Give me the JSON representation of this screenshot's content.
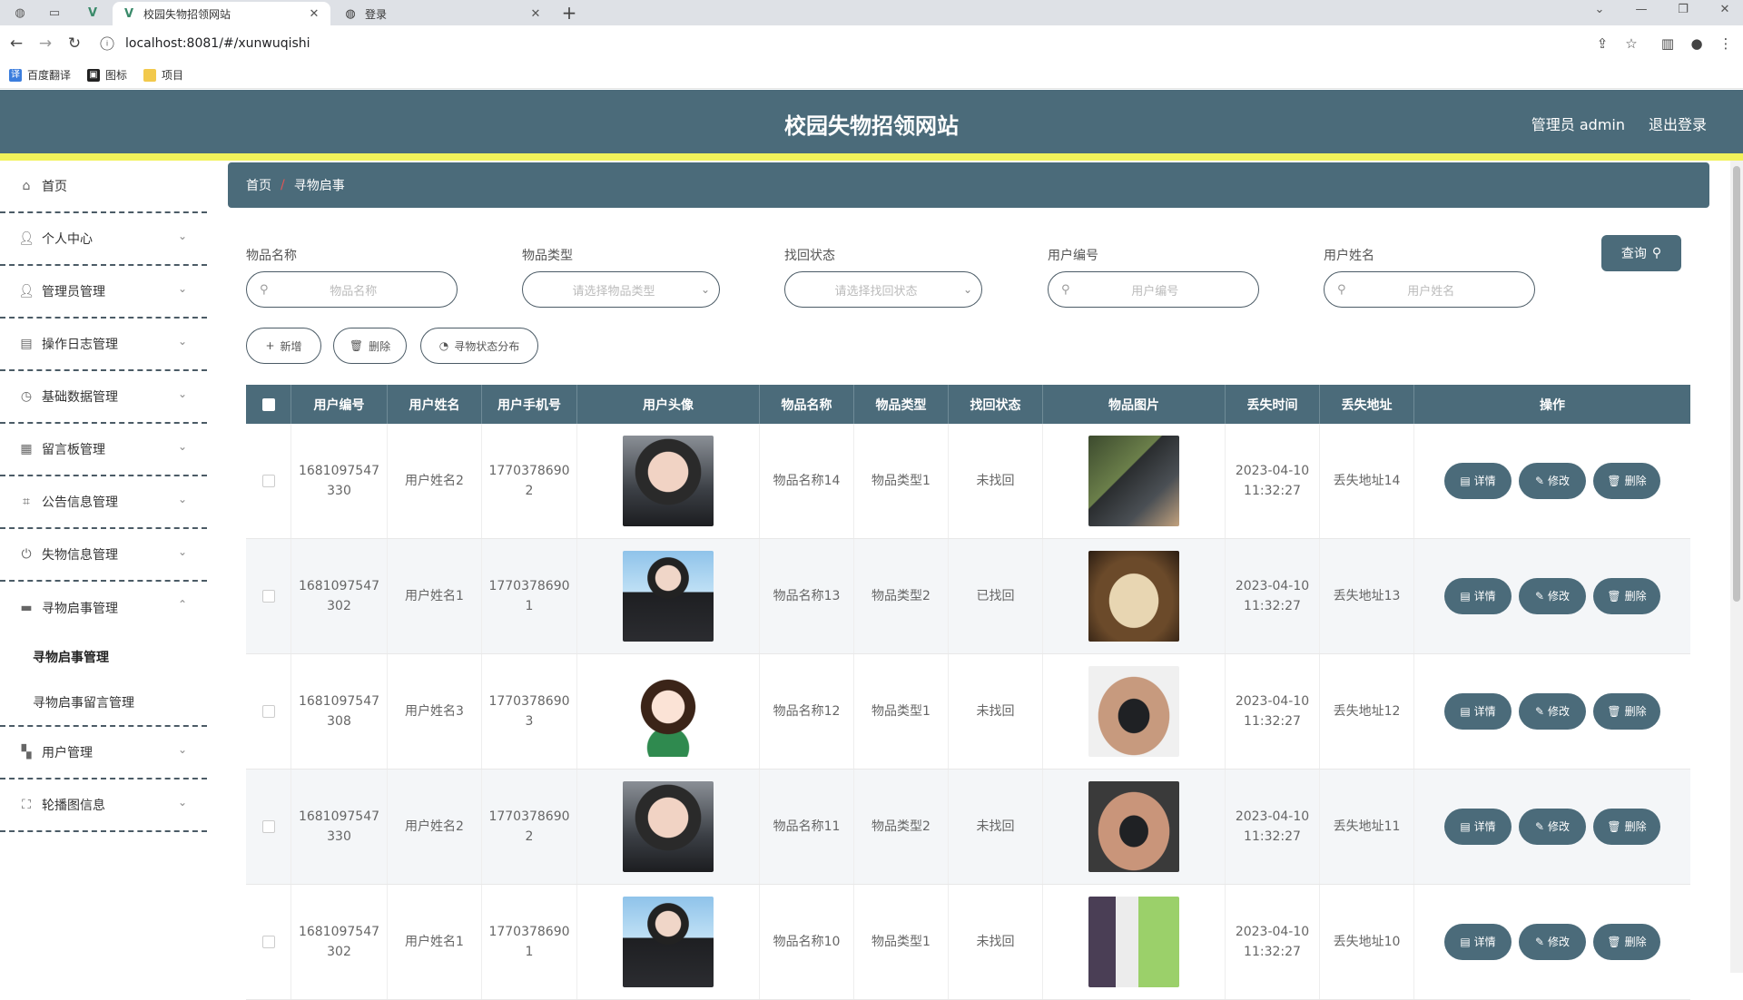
{
  "browser": {
    "tabs": [
      {
        "title": "校园失物招领网站",
        "active": true
      },
      {
        "title": "登录",
        "active": false
      }
    ],
    "url": "localhost:8081/#/xunwuqishi",
    "bookmarks": [
      "百度翻译",
      "图标",
      "项目"
    ]
  },
  "header": {
    "title": "校园失物招领网站",
    "user": "管理员 admin",
    "logout": "退出登录"
  },
  "sidebar": {
    "items": [
      {
        "label": "首页",
        "icon": "home-icon"
      },
      {
        "label": "个人中心",
        "icon": "user-icon"
      },
      {
        "label": "管理员管理",
        "icon": "user-icon"
      },
      {
        "label": "操作日志管理",
        "icon": "briefcase-icon"
      },
      {
        "label": "基础数据管理",
        "icon": "gauge-icon"
      },
      {
        "label": "留言板管理",
        "icon": "clipboard-icon"
      },
      {
        "label": "公告信息管理",
        "icon": "crop-icon"
      },
      {
        "label": "失物信息管理",
        "icon": "power-icon"
      },
      {
        "label": "寻物启事管理",
        "icon": "monitor-icon"
      },
      {
        "label": "用户管理",
        "icon": "grid-icon"
      },
      {
        "label": "轮播图信息",
        "icon": "fullscreen-icon"
      }
    ],
    "submenu": [
      "寻物启事管理",
      "寻物启事留言管理"
    ]
  },
  "breadcrumb": {
    "home": "首页",
    "sep": "/",
    "current": "寻物启事"
  },
  "filters": [
    {
      "label": "物品名称",
      "placeholder": "物品名称",
      "type": "input"
    },
    {
      "label": "物品类型",
      "placeholder": "请选择物品类型",
      "type": "select"
    },
    {
      "label": "找回状态",
      "placeholder": "请选择找回状态",
      "type": "select"
    },
    {
      "label": "用户编号",
      "placeholder": "用户编号",
      "type": "input"
    },
    {
      "label": "用户姓名",
      "placeholder": "用户姓名",
      "type": "input"
    }
  ],
  "search_label": "查询",
  "actions": {
    "add": "新增",
    "delete": "删除",
    "stats": "寻物状态分布"
  },
  "table": {
    "columns": [
      "用户编号",
      "用户姓名",
      "用户手机号",
      "用户头像",
      "物品名称",
      "物品类型",
      "找回状态",
      "物品图片",
      "丢失时间",
      "丢失地址",
      "操作"
    ],
    "ops": {
      "detail": "详情",
      "edit": "修改",
      "delete": "删除"
    },
    "rows": [
      {
        "id": "1681097547330",
        "name": "用户姓名2",
        "phone": "17703786902",
        "item": "物品名称14",
        "type": "物品类型1",
        "status": "未找回",
        "time": "2023-04-10 11:32:27",
        "addr": "丢失地址14"
      },
      {
        "id": "1681097547302",
        "name": "用户姓名1",
        "phone": "17703786901",
        "item": "物品名称13",
        "type": "物品类型2",
        "status": "已找回",
        "time": "2023-04-10 11:32:27",
        "addr": "丢失地址13"
      },
      {
        "id": "1681097547308",
        "name": "用户姓名3",
        "phone": "17703786903",
        "item": "物品名称12",
        "type": "物品类型1",
        "status": "未找回",
        "time": "2023-04-10 11:32:27",
        "addr": "丢失地址12"
      },
      {
        "id": "1681097547330",
        "name": "用户姓名2",
        "phone": "17703786902",
        "item": "物品名称11",
        "type": "物品类型2",
        "status": "未找回",
        "time": "2023-04-10 11:32:27",
        "addr": "丢失地址11"
      },
      {
        "id": "1681097547302",
        "name": "用户姓名1",
        "phone": "17703786901",
        "item": "物品名称10",
        "type": "物品类型1",
        "status": "未找回",
        "time": "2023-04-10 11:32:27",
        "addr": "丢失地址10"
      }
    ]
  },
  "colors": {
    "primary": "#4b6b7a",
    "accent": "#f2f25a",
    "breadcrumb_sep": "#e25555"
  }
}
